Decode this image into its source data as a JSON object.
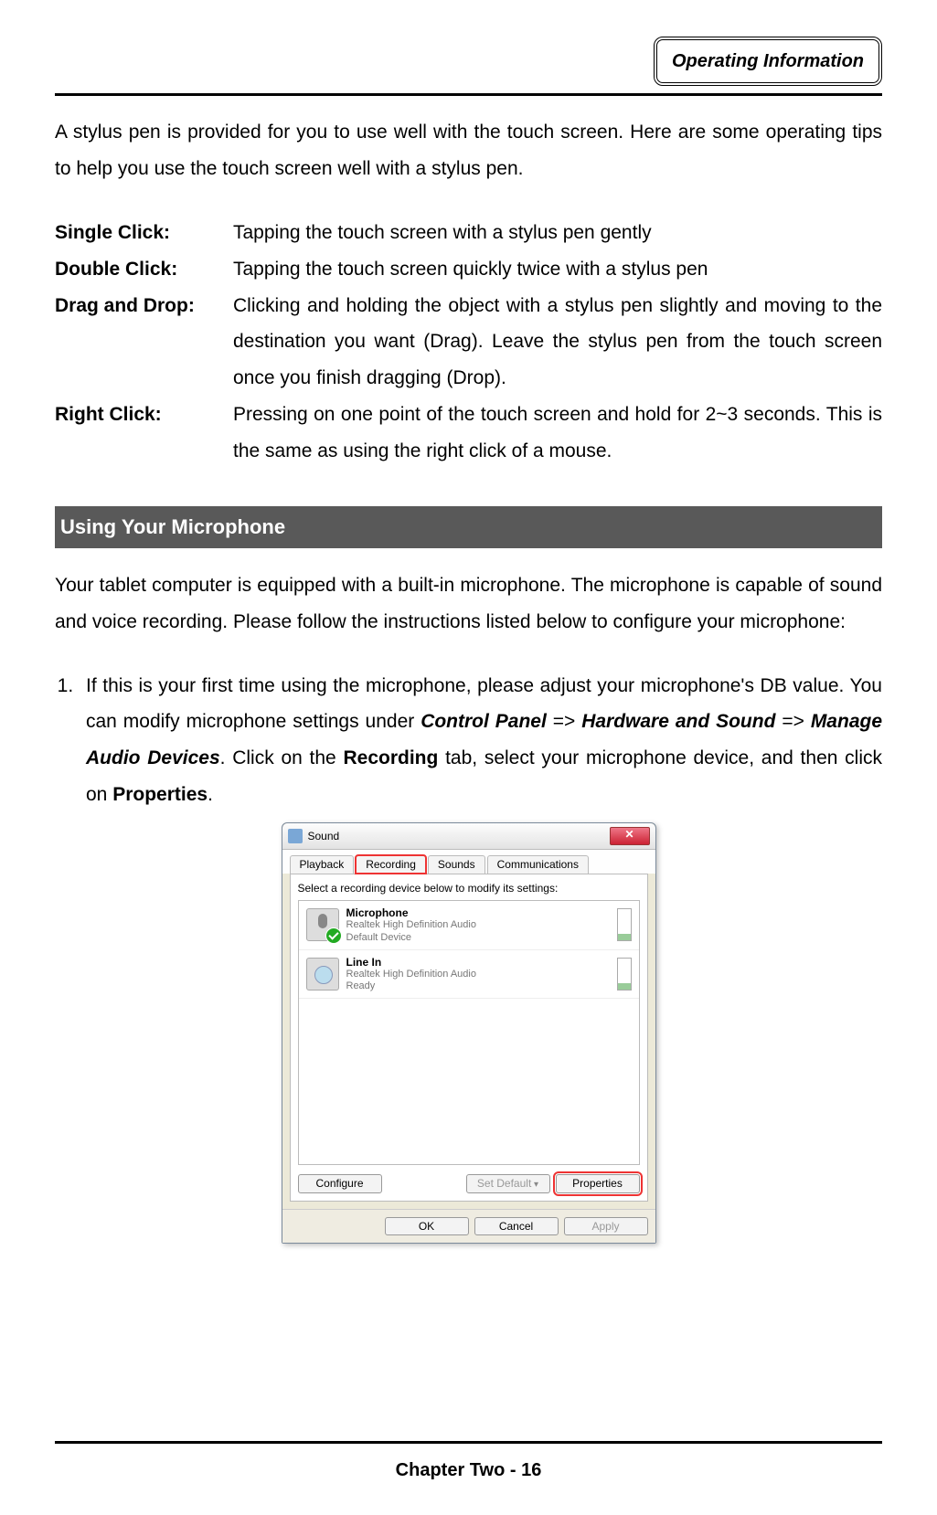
{
  "header": {
    "badge": "Operating Information"
  },
  "intro": "A stylus pen is provided for you to use well with the touch screen. Here are some operating tips to help you use the touch screen well with a stylus pen.",
  "tips": {
    "single_click": {
      "term": "Single Click:",
      "desc": "Tapping the touch screen with a stylus pen gently"
    },
    "double_click": {
      "term": "Double Click:",
      "desc": "Tapping the touch screen quickly twice with a stylus pen"
    },
    "drag_drop": {
      "term": "Drag and Drop:",
      "desc": "Clicking and holding the object with a stylus pen slightly and moving to the destination you want (Drag). Leave the stylus pen from the touch screen once you finish dragging (Drop)."
    },
    "right_click": {
      "term": "Right Click:",
      "desc": "Pressing on one point of the touch screen and hold for 2~3 seconds. This is the same as using the right click of a mouse."
    }
  },
  "section_title": " Using Your Microphone",
  "mic_intro": "Your tablet computer is equipped with a built-in microphone. The microphone is capable of sound and voice recording. Please follow the instructions listed below to configure your microphone:",
  "step1": {
    "s1": "If this is your first time using the microphone, please adjust your microphone's DB value. You can modify microphone settings under ",
    "cp": "Control Panel",
    "arr": " => ",
    "hs": "Hardware and Sound",
    "mad": "Manage Audio Devices",
    "s2": ". Click on the ",
    "rec": "Recording",
    "s3": " tab, select your microphone device, and then click on ",
    "prop": "Properties",
    "s4": "."
  },
  "dialog": {
    "title": "Sound",
    "tabs": {
      "playback": "Playback",
      "recording": "Recording",
      "sounds": "Sounds",
      "communications": "Communications"
    },
    "instruction": "Select a recording device below to modify its settings:",
    "devices": {
      "mic": {
        "name": "Microphone",
        "sub1": "Realtek High Definition Audio",
        "sub2": "Default Device"
      },
      "linein": {
        "name": "Line In",
        "sub1": "Realtek High Definition Audio",
        "sub2": "Ready"
      }
    },
    "buttons": {
      "configure": "Configure",
      "set_default": "Set Default",
      "properties": "Properties",
      "ok": "OK",
      "cancel": "Cancel",
      "apply": "Apply"
    }
  },
  "footer": "Chapter Two - 16"
}
